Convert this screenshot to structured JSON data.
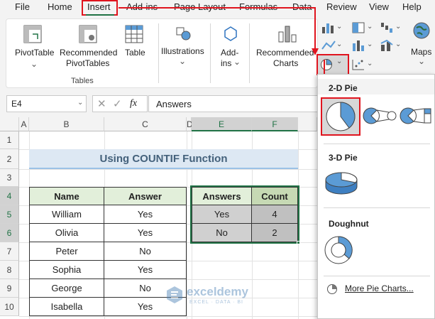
{
  "menu": {
    "tabs": [
      "File",
      "Home",
      "Insert",
      "Add-ins",
      "Page Layout",
      "Formulas",
      "Data",
      "Review",
      "View",
      "Help"
    ]
  },
  "ribbon": {
    "pivottable_label": "PivotTable",
    "recommended_pivottables_line1": "Recommended",
    "recommended_pivottables_line2": "PivotTables",
    "table_label": "Table",
    "tables_group_label": "Tables",
    "illustrations_label": "Illustrations",
    "addins_line1": "Add-",
    "addins_line2": "ins",
    "recommended_charts_line1": "Recommended",
    "recommended_charts_line2": "Charts",
    "maps_label": "Maps"
  },
  "formula_bar": {
    "name_box": "E4",
    "fx_label": "fx",
    "content": "Answers"
  },
  "columns": [
    "A",
    "B",
    "C",
    "D",
    "E",
    "F"
  ],
  "rows": [
    "1",
    "2",
    "3",
    "4",
    "5",
    "6",
    "7",
    "8",
    "9",
    "10"
  ],
  "title": "Using COUNTIF Function",
  "main_table": {
    "headers": [
      "Name",
      "Answer"
    ],
    "rows": [
      [
        "William",
        "Yes"
      ],
      [
        "Olivia",
        "Yes"
      ],
      [
        "Peter",
        "No"
      ],
      [
        "Sophia",
        "Yes"
      ],
      [
        "George",
        "No"
      ],
      [
        "Isabella",
        "Yes"
      ]
    ]
  },
  "summary_table": {
    "headers": [
      "Answers",
      "Count"
    ],
    "rows": [
      [
        "Yes",
        "4"
      ],
      [
        "No",
        "2"
      ]
    ]
  },
  "dropdown": {
    "section_2d": "2-D Pie",
    "section_3d": "3-D Pie",
    "section_doughnut": "Doughnut",
    "more_label": "More Pie Charts..."
  },
  "watermark": {
    "name": "exceldemy",
    "tagline": "EXCEL · DATA · BI"
  },
  "colors": {
    "accent_red": "#e0141e",
    "title_fill": "#dde8f3",
    "title_text": "#44617b",
    "header_fill": "#e2efda",
    "summary_header_fill": "#c6d9b4",
    "summary_cell_fill": "#d0d0d0",
    "selection_green": "#217346",
    "pie_blue": "#5b9bd5"
  }
}
